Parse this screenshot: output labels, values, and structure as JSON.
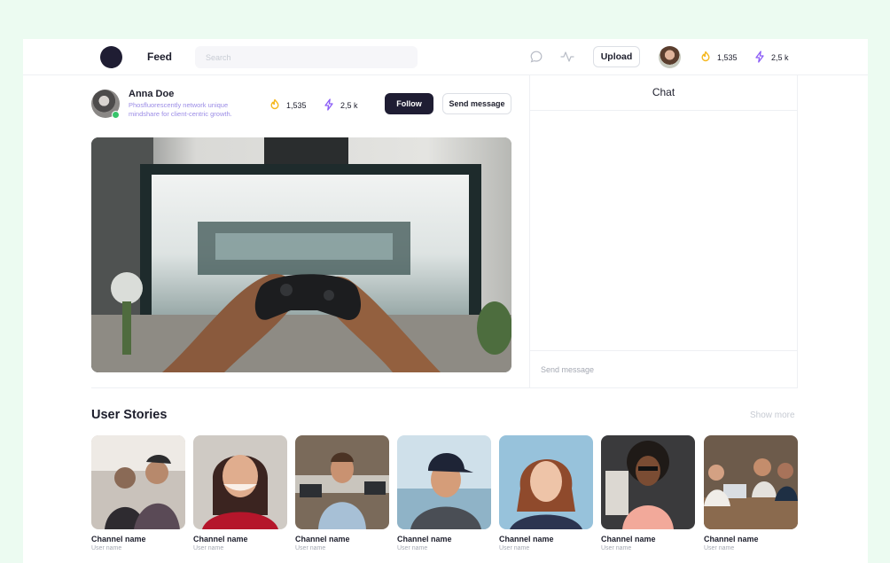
{
  "header": {
    "feed_label": "Feed",
    "search_placeholder": "Search",
    "upload_label": "Upload",
    "coins": "1,535",
    "energy": "2,5 k",
    "colors": {
      "coin": "#f5b820",
      "energy": "#8b5cf6",
      "dark": "#1f1d33"
    }
  },
  "profile": {
    "name": "Anna Doe",
    "bio": "Phosfluorescently network unique mindshare for client-centric growth.",
    "coins": "1,535",
    "energy": "2,5 k",
    "follow_label": "Follow",
    "message_label": "Send message"
  },
  "chat": {
    "title": "Chat",
    "input_placeholder": "Send message"
  },
  "stories": {
    "title": "User Stories",
    "show_more": "Show more",
    "items": [
      {
        "channel": "Channel name",
        "user": "User name"
      },
      {
        "channel": "Channel name",
        "user": "User name"
      },
      {
        "channel": "Channel name",
        "user": "User name"
      },
      {
        "channel": "Channel name",
        "user": "User name"
      },
      {
        "channel": "Channel name",
        "user": "User name"
      },
      {
        "channel": "Channel name",
        "user": "User name"
      },
      {
        "channel": "Channel name",
        "user": "User name"
      }
    ]
  }
}
